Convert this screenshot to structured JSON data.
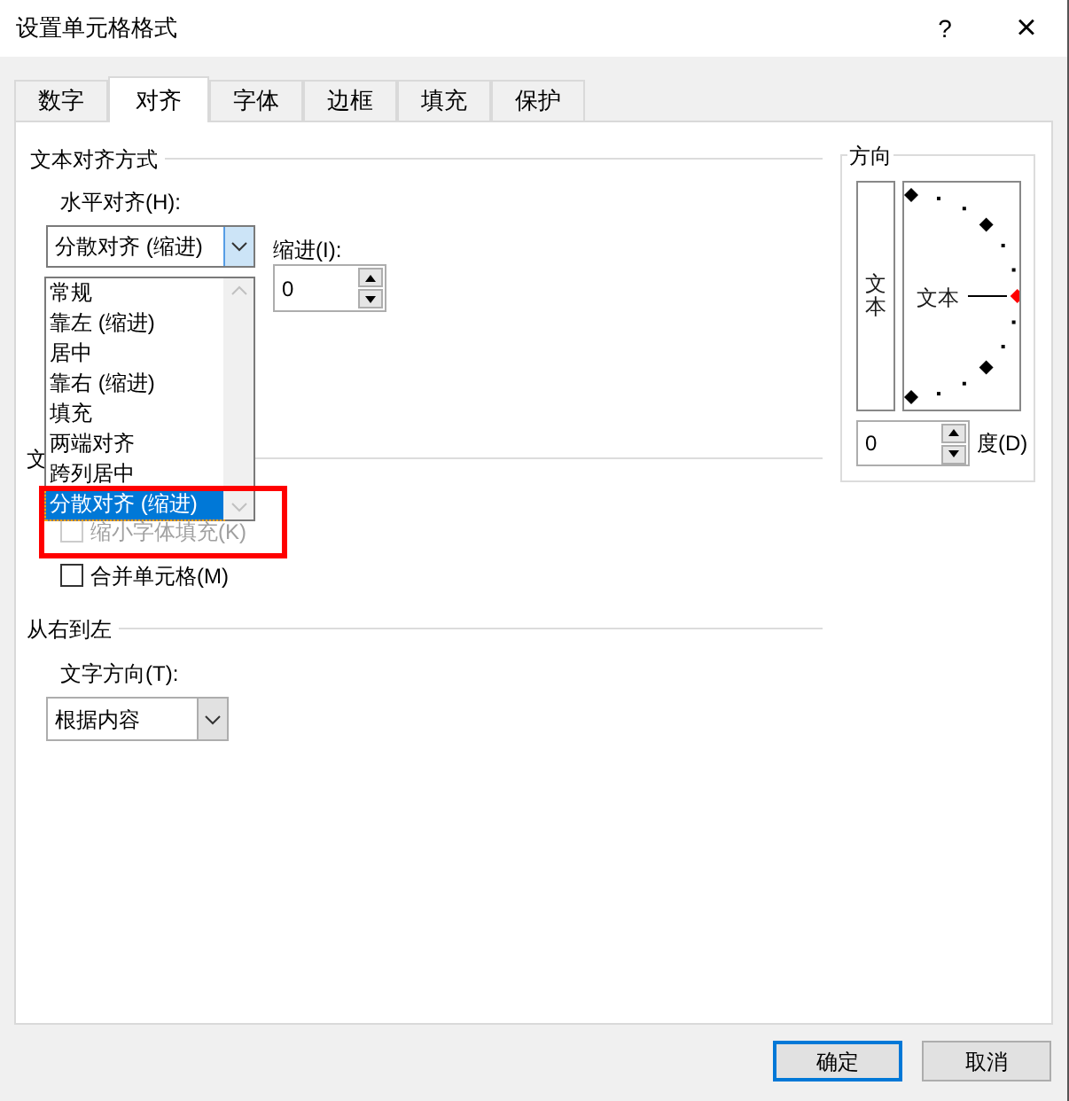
{
  "window": {
    "title": "设置单元格格式",
    "help": "?",
    "close": "×"
  },
  "tabs": [
    {
      "label": "数字",
      "selected": false
    },
    {
      "label": "对齐",
      "selected": true
    },
    {
      "label": "字体",
      "selected": false
    },
    {
      "label": "边框",
      "selected": false
    },
    {
      "label": "填充",
      "selected": false
    },
    {
      "label": "保护",
      "selected": false
    }
  ],
  "text_alignment": {
    "title": "文本对齐方式",
    "horizontal_label": "水平对齐(H):",
    "horizontal_value": "分散对齐 (缩进)",
    "dropdown_open": true,
    "indent_label": "缩进(I):",
    "indent_value": "0",
    "options": [
      {
        "label": "常规",
        "selected": false
      },
      {
        "label": "靠左 (缩进)",
        "selected": false
      },
      {
        "label": "居中",
        "selected": false
      },
      {
        "label": "靠右 (缩进)",
        "selected": false
      },
      {
        "label": "填充",
        "selected": false
      },
      {
        "label": "两端对齐",
        "selected": false
      },
      {
        "label": "跨列居中",
        "selected": false
      },
      {
        "label": "分散对齐 (缩进)",
        "selected": true
      }
    ]
  },
  "text_control": {
    "title_visible": "文",
    "options": [
      {
        "label": "缩小字体填充(K)",
        "checked": false,
        "disabled": true
      },
      {
        "label": "合并单元格(M)",
        "checked": false,
        "disabled": false
      }
    ]
  },
  "right_to_left": {
    "title": "从右到左",
    "direction_label": "文字方向(T):",
    "direction_value": "根据内容"
  },
  "orientation": {
    "title": "方向",
    "vertical_text": "文本",
    "dial_text": "文本",
    "degrees_value": "0",
    "degrees_label": "度(D)"
  },
  "annotation": {
    "kind": "highlight-box"
  },
  "buttons": [
    {
      "label": "确定",
      "default": true
    },
    {
      "label": "取消",
      "default": false
    }
  ]
}
